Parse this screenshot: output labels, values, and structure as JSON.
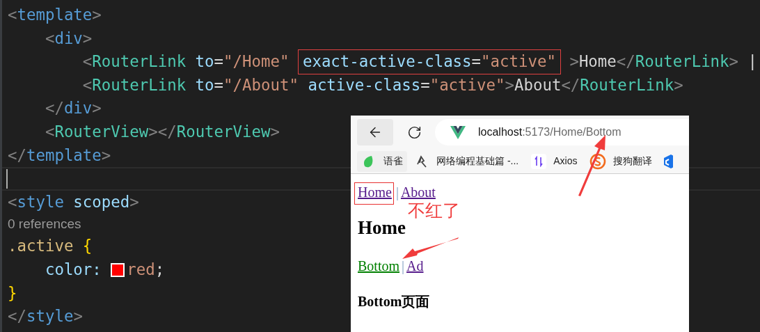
{
  "editor": {
    "lines": [
      {
        "tokens": [
          {
            "kind": "punct",
            "text": "<"
          },
          {
            "kind": "tag",
            "text": "template"
          },
          {
            "kind": "punct",
            "text": ">"
          }
        ]
      },
      {
        "tokens": [
          {
            "kind": "punct",
            "text": "    <"
          },
          {
            "kind": "tag",
            "text": "div"
          },
          {
            "kind": "punct",
            "text": ">"
          }
        ]
      },
      {
        "tokens": [
          {
            "kind": "punct",
            "text": "        <"
          },
          {
            "kind": "component",
            "text": "RouterLink"
          },
          {
            "kind": "attr",
            "text": " to"
          },
          {
            "kind": "plain",
            "text": "="
          },
          {
            "kind": "string",
            "text": "\"/Home\" "
          },
          {
            "kind": "attr",
            "text": "exact-active-class",
            "boxed": true
          },
          {
            "kind": "plain",
            "text": "=",
            "boxed": true
          },
          {
            "kind": "string",
            "text": "\"active\"",
            "boxed": true
          },
          {
            "kind": "punct",
            "text": " >"
          },
          {
            "kind": "plain",
            "text": "Home"
          },
          {
            "kind": "punct",
            "text": "</"
          },
          {
            "kind": "component",
            "text": "RouterLink"
          },
          {
            "kind": "punct",
            "text": ">"
          },
          {
            "kind": "plain",
            "text": " |"
          }
        ]
      },
      {
        "tokens": [
          {
            "kind": "punct",
            "text": "        <"
          },
          {
            "kind": "component",
            "text": "RouterLink"
          },
          {
            "kind": "attr",
            "text": " to"
          },
          {
            "kind": "plain",
            "text": "="
          },
          {
            "kind": "string",
            "text": "\"/About\""
          },
          {
            "kind": "attr",
            "text": " active-class"
          },
          {
            "kind": "plain",
            "text": "="
          },
          {
            "kind": "string",
            "text": "\"active\""
          },
          {
            "kind": "punct",
            "text": ">"
          },
          {
            "kind": "plain",
            "text": "About"
          },
          {
            "kind": "punct",
            "text": "</"
          },
          {
            "kind": "component",
            "text": "RouterLink"
          },
          {
            "kind": "punct",
            "text": ">"
          }
        ]
      },
      {
        "tokens": [
          {
            "kind": "punct",
            "text": "    </"
          },
          {
            "kind": "tag",
            "text": "div"
          },
          {
            "kind": "punct",
            "text": ">"
          }
        ]
      },
      {
        "tokens": [
          {
            "kind": "punct",
            "text": "    <"
          },
          {
            "kind": "component",
            "text": "RouterView"
          },
          {
            "kind": "punct",
            "text": "></"
          },
          {
            "kind": "component",
            "text": "RouterView"
          },
          {
            "kind": "punct",
            "text": ">"
          }
        ]
      },
      {
        "tokens": [
          {
            "kind": "punct",
            "text": "</"
          },
          {
            "kind": "tag",
            "text": "template"
          },
          {
            "kind": "punct",
            "text": ">"
          }
        ]
      },
      {
        "current": true
      },
      {
        "tokens": [
          {
            "kind": "punct",
            "text": "<"
          },
          {
            "kind": "tag",
            "text": "style"
          },
          {
            "kind": "attr",
            "text": " scoped"
          },
          {
            "kind": "punct",
            "text": ">"
          }
        ]
      },
      {
        "kind": "codelens",
        "tokens": [
          {
            "kind": "lens",
            "text": "0 references"
          }
        ]
      },
      {
        "tokens": [
          {
            "kind": "selector",
            "text": ".active "
          },
          {
            "kind": "brace",
            "text": "{"
          }
        ]
      },
      {
        "tokens": [
          {
            "kind": "attr",
            "text": "    color: "
          },
          {
            "kind": "swatch",
            "color": "#ff0000"
          },
          {
            "kind": "string",
            "text": "red"
          },
          {
            "kind": "plain",
            "text": ";"
          }
        ]
      },
      {
        "tokens": [
          {
            "kind": "brace",
            "text": "}"
          }
        ]
      },
      {
        "tokens": [
          {
            "kind": "punct",
            "text": "</"
          },
          {
            "kind": "tag",
            "text": "style"
          },
          {
            "kind": "punct",
            "text": ">"
          }
        ]
      }
    ]
  },
  "browser": {
    "address": {
      "host": "localhost",
      "path": ":5173/Home/Bottom"
    },
    "bookmarks": [
      {
        "kind": "blob",
        "label": "语雀"
      },
      {
        "kind": "pen",
        "label": "网络编程基础篇 -..."
      },
      {
        "kind": "arrows",
        "label": "Axios"
      },
      {
        "kind": "swirl",
        "label": "搜狗翻译"
      },
      {
        "kind": "hexagon"
      }
    ],
    "page": [
      {
        "kind": "nav",
        "items": [
          {
            "kind": "link",
            "text": "Home",
            "active": false,
            "boxed": true
          },
          {
            "kind": "separator",
            "text": "|"
          },
          {
            "kind": "link",
            "text": "About",
            "active": false,
            "boxed": false
          }
        ]
      },
      {
        "kind": "h1",
        "text": "Home"
      },
      {
        "kind": "nav",
        "items": [
          {
            "kind": "link",
            "text": "Bottom",
            "active": true,
            "boxed": false
          },
          {
            "kind": "separator",
            "text": "|"
          },
          {
            "kind": "link",
            "text": "Ad",
            "active": false,
            "boxed": false
          }
        ]
      },
      {
        "kind": "h3",
        "text": "Bottom页面"
      }
    ]
  },
  "annotation": {
    "note": "不红了"
  }
}
